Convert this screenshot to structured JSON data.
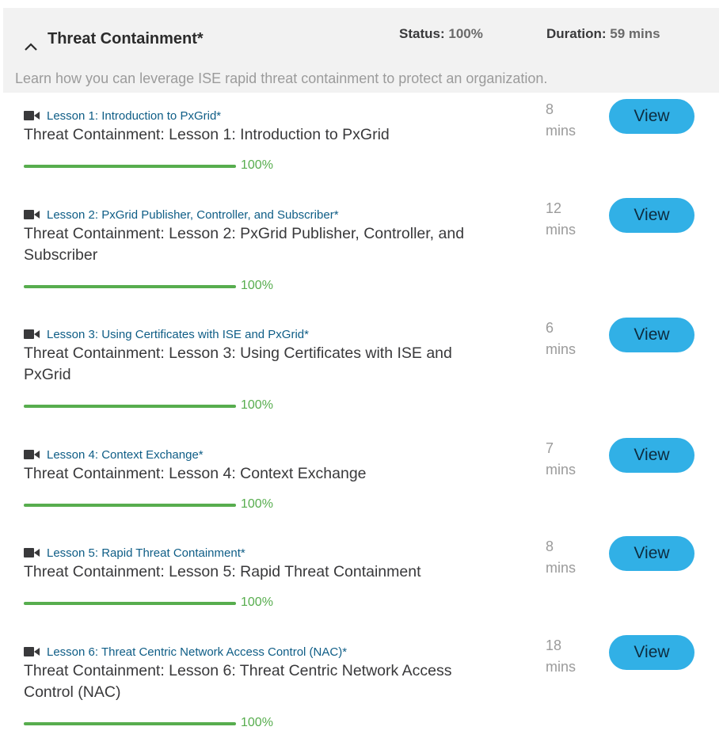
{
  "module": {
    "title": "Threat Containment*",
    "status_label": "Status:",
    "status_value": "100%",
    "duration_label": "Duration:",
    "duration_value": "59 mins",
    "description": "Learn how you can leverage ISE rapid threat containment to protect an organization."
  },
  "colors": {
    "header_bg": "#f2f2f2",
    "link": "#0e5d86",
    "progress": "#57ad4e",
    "button": "#31b0e6"
  },
  "icons": {
    "collapse": "chevron-up-icon",
    "lesson_type": "video-camera-icon"
  },
  "lessons": [
    {
      "link": "Lesson 1: Introduction to PxGrid*",
      "title": "Threat Containment: Lesson 1: Introduction to PxGrid",
      "progress": 100,
      "progress_label": "100%",
      "duration_num": "8",
      "duration_unit": "mins",
      "button": "View"
    },
    {
      "link": "Lesson 2: PxGrid Publisher, Controller, and Subscriber*",
      "title": "Threat Containment: Lesson 2: PxGrid Publisher, Controller, and Subscriber",
      "progress": 100,
      "progress_label": "100%",
      "duration_num": "12",
      "duration_unit": "mins",
      "button": "View"
    },
    {
      "link": "Lesson 3: Using Certificates with ISE and PxGrid*",
      "title": "Threat Containment: Lesson 3: Using Certificates with ISE and PxGrid",
      "progress": 100,
      "progress_label": "100%",
      "duration_num": "6",
      "duration_unit": "mins",
      "button": "View"
    },
    {
      "link": "Lesson 4: Context Exchange*",
      "title": "Threat Containment: Lesson 4: Context Exchange",
      "progress": 100,
      "progress_label": "100%",
      "duration_num": "7",
      "duration_unit": "mins",
      "button": "View"
    },
    {
      "link": "Lesson 5: Rapid Threat Containment*",
      "title": "Threat Containment: Lesson 5: Rapid Threat Containment",
      "progress": 100,
      "progress_label": "100%",
      "duration_num": "8",
      "duration_unit": "mins",
      "button": "View"
    },
    {
      "link": "Lesson 6: Threat Centric Network Access Control (NAC)*",
      "title": "Threat Containment: Lesson 6: Threat Centric Network Access Control (NAC)",
      "progress": 100,
      "progress_label": "100%",
      "duration_num": "18",
      "duration_unit": "mins",
      "button": "View"
    }
  ]
}
